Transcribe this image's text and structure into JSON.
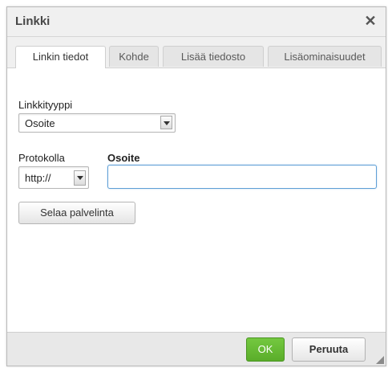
{
  "dialog": {
    "title": "Linkki",
    "close_icon": "close-icon"
  },
  "tabs": [
    {
      "label": "Linkin tiedot",
      "active": true
    },
    {
      "label": "Kohde",
      "active": false
    },
    {
      "label": "Lisää tiedosto",
      "active": false
    },
    {
      "label": "Lisäominaisuudet",
      "active": false
    }
  ],
  "form": {
    "link_type_label": "Linkkityyppi",
    "link_type_value": "Osoite",
    "protocol_label": "Protokolla",
    "protocol_value": "http://",
    "address_label": "Osoite",
    "address_value": "",
    "browse_button": "Selaa palvelinta"
  },
  "footer": {
    "ok_label": "OK",
    "cancel_label": "Peruuta"
  },
  "colors": {
    "ok_green": "#5cb32d",
    "input_focus_border": "#5f9fd6"
  }
}
